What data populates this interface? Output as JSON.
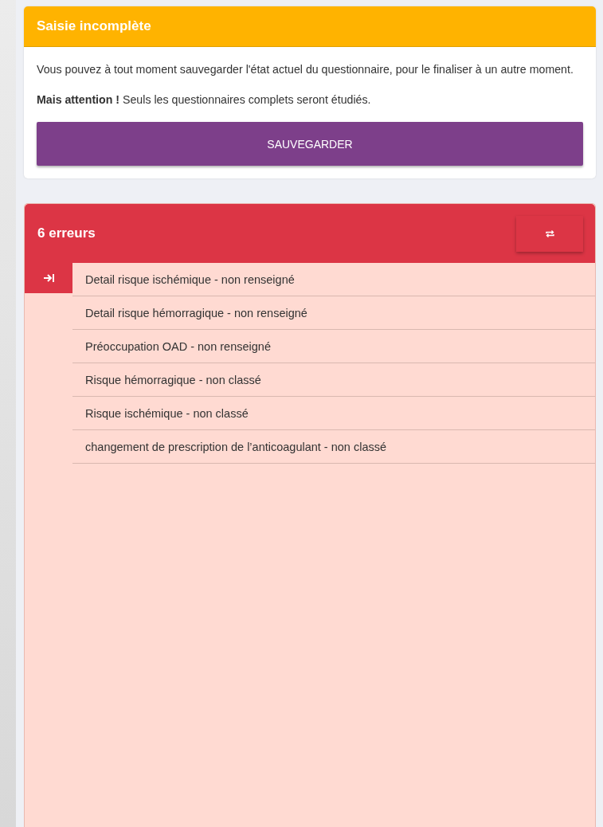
{
  "notice": {
    "title": "Saisie incomplète",
    "paragraphs": [
      "Vous pouvez à tout moment sauvegarder l'état actuel du questionnaire, pour le finaliser à un autre moment.",
      "**Mais attention !** Seuls les questionnaires complets seront étudiés."
    ],
    "button": "SAUVEGARDER"
  },
  "errors": {
    "title": "6 erreurs",
    "items": [
      {
        "label": "Detail risque ischémique - non renseigné",
        "selected": true
      },
      {
        "label": "Detail risque hémorragique - non renseigné",
        "selected": false
      },
      {
        "label": "Préoccupation OAD - non renseigné",
        "selected": false
      },
      {
        "label": "Risque hémorragique - non classé",
        "selected": false
      },
      {
        "label": "Risque ischémique - non classé",
        "selected": false
      },
      {
        "label": "changement de prescription de l’anticoagulant - non classé",
        "selected": false
      }
    ]
  }
}
